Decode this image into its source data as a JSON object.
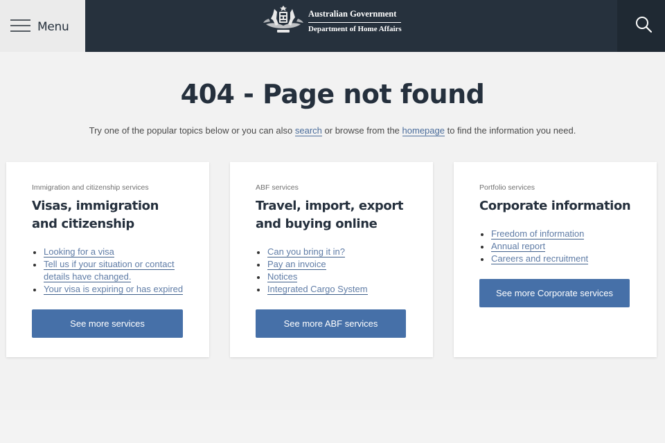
{
  "header": {
    "menu_label": "Menu",
    "logo": {
      "line1": "Australian Government",
      "line2": "Department of Home Affairs"
    },
    "icons": {
      "menu": "hamburger-icon",
      "search": "search-icon",
      "crest": "coat-of-arms-icon"
    }
  },
  "main": {
    "title": "404 - Page not found",
    "intro": {
      "before_search": "Try one of the popular topics below or you can also ",
      "search_link": "search",
      "between": " or browse from the ",
      "homepage_link": "homepage",
      "after": " to find the information you need."
    },
    "cards": [
      {
        "kicker": "Immigration and citizenship services",
        "title": "Visas, immigration and citizenship",
        "links": [
          "Looking for a visa",
          "Tell us if your situation or contact details have changed.",
          "Your visa is expiring or has expired"
        ],
        "button": "See more services"
      },
      {
        "kicker": "ABF services",
        "title": "Travel, import, export and buying online",
        "links": [
          "Can you bring it in?",
          "Pay an invoice",
          "Notices",
          "Integrated Cargo System"
        ],
        "button": "See more ABF services"
      },
      {
        "kicker": "Portfolio services",
        "title": "Corporate information",
        "links": [
          "Freedom of information",
          "Annual report",
          "Careers and recruitment"
        ],
        "button": "See more Corporate services"
      }
    ]
  },
  "colors": {
    "header_bg": "#26313d",
    "menu_bg": "#ebebeb",
    "button_bg": "#4670a8",
    "link": "#5f7ca6",
    "page_bg": "#f2f2f2"
  }
}
